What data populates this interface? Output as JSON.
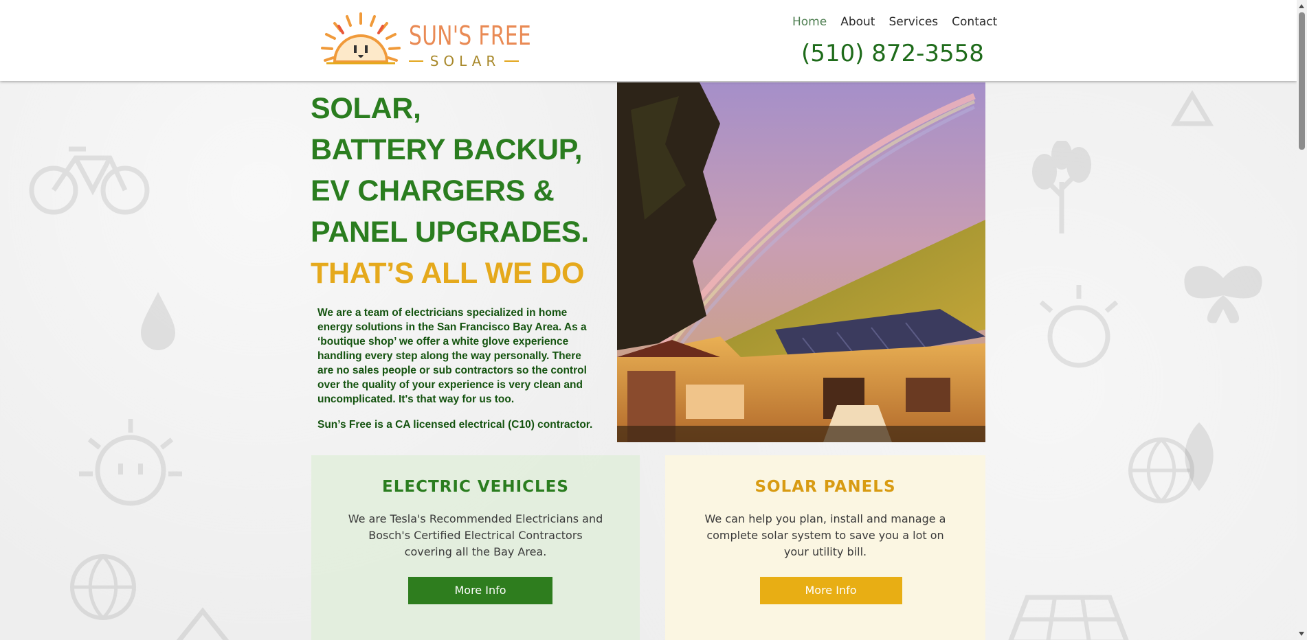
{
  "brand": {
    "name": "SUN'S FREE",
    "sub": "SOLAR",
    "colors": {
      "orange": "#e98a54",
      "gold": "#e2a61d",
      "green": "#2a7d1f"
    }
  },
  "nav": {
    "items": [
      {
        "label": "Home",
        "active": true
      },
      {
        "label": "About"
      },
      {
        "label": "Services"
      },
      {
        "label": "Contact"
      }
    ],
    "phone": "(510) 872-3558"
  },
  "hero": {
    "lines": [
      "SOLAR,",
      "BATTERY BACKUP,",
      "EV CHARGERS &",
      "PANEL UPGRADES."
    ],
    "tagline": "THAT’S ALL WE DO",
    "intro": "We are a team of electricians specialized in home energy solutions in the San Francisco Bay Area. As a ‘boutique shop’ we offer a white glove experience handling every step along the way personally. There are no sales people or sub contractors so the control over the quality of your experience is very clean and uncomplicated. It's that way for us too.",
    "license": "Sun’s Free is a CA licensed electrical (C10) contractor."
  },
  "cards": {
    "ev": {
      "title": "ELECTRIC VEHICLES",
      "text": "We are Tesla's Recommended Electricians and Bosch's Certified Electrical Contractors covering all the Bay Area.",
      "button": "More Info"
    },
    "solar": {
      "title": "SOLAR PANELS",
      "text": "We can help you plan, install and manage a complete solar system to save you a lot on your utility bill.",
      "button": "More Info"
    }
  },
  "icons": [
    "sun-outlet-logo-icon",
    "bicycle-icon",
    "water-drop-icon",
    "tree-icon",
    "butterfly-icon",
    "globe-icon",
    "leaf-icon",
    "solar-panel-icon",
    "recycle-icon"
  ]
}
